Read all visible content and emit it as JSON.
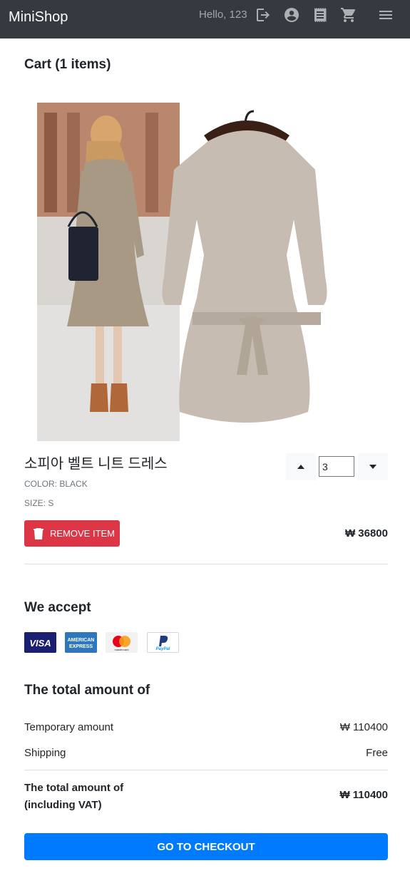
{
  "navbar": {
    "brand": "MiniShop",
    "greeting": "Hello, 123",
    "icons": [
      "logout-icon",
      "account-icon",
      "orders-icon",
      "cart-icon",
      "menu-icon"
    ]
  },
  "cart": {
    "heading": "Cart (1 items)",
    "item": {
      "name": "소피아 벨트 니트 드레스",
      "color": "COLOR: BLACK",
      "size": "SIZE: S",
      "quantity": "3",
      "price": "₩ 36800",
      "remove_label": "REMOVE ITEM"
    }
  },
  "payment": {
    "heading": "We accept",
    "cards": [
      {
        "name": "VISA",
        "color": "#1a1f71"
      },
      {
        "name": "AMERICAN EXPRESS",
        "color": "#2e77bc"
      },
      {
        "name": "mastercard",
        "color": "#f2f2f2"
      },
      {
        "name": "PayPal",
        "color": "#ffffff"
      }
    ]
  },
  "summary": {
    "heading": "The total amount of",
    "temporary_label": "Temporary amount",
    "temporary_value": "₩ 110400",
    "shipping_label": "Shipping",
    "shipping_value": "Free",
    "total_label_line1": "The total amount of",
    "total_label_line2": "(including VAT)",
    "total_value": "₩ 110400",
    "checkout_label": "GO TO CHECKOUT"
  },
  "colors": {
    "navbar": "#343a40",
    "danger": "#dc3545",
    "primary": "#007bff"
  }
}
